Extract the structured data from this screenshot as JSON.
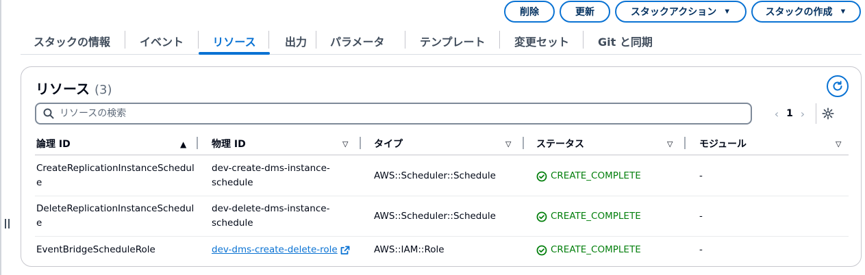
{
  "header": {
    "buttons": [
      {
        "label": "削除"
      },
      {
        "label": "更新"
      },
      {
        "label": "スタックアクション",
        "caret": "▼"
      },
      {
        "label": "スタックの作成",
        "caret": "▼"
      }
    ]
  },
  "tabs": [
    {
      "label": "スタックの情報"
    },
    {
      "label": "イベント"
    },
    {
      "label": "リソース"
    },
    {
      "label": "出力"
    },
    {
      "label": "パラメータ"
    },
    {
      "label": "テンプレート"
    },
    {
      "label": "変更セット"
    },
    {
      "label": "Git と同期"
    }
  ],
  "panel": {
    "title": "リソース",
    "count": "(3)",
    "search_placeholder": "リソースの検索",
    "page": "1"
  },
  "table": {
    "columns": [
      {
        "label": "論理 ID",
        "sort": "▲"
      },
      {
        "label": "物理 ID",
        "sort": "▽"
      },
      {
        "label": "タイプ",
        "sort": "▽"
      },
      {
        "label": "ステータス",
        "sort": "▽"
      },
      {
        "label": "モジュール",
        "sort": "▽"
      }
    ],
    "rows": [
      {
        "logical_l1": "CreateReplicationInstanceSchedul",
        "logical_l2": "e",
        "physical_l1": "dev-create-dms-instance-",
        "physical_l2": "schedule",
        "type": "AWS::Scheduler::Schedule",
        "status": "CREATE_COMPLETE",
        "module": "-"
      },
      {
        "logical_l1": "DeleteReplicationInstanceSchedul",
        "logical_l2": "e",
        "physical_l1": "dev-delete-dms-instance-",
        "physical_l2": "schedule",
        "type": "AWS::Scheduler::Schedule",
        "status": "CREATE_COMPLETE",
        "module": "-"
      },
      {
        "logical_l1": "EventBridgeScheduleRole",
        "physical_link": "dev-dms-create-delete-role",
        "type": "AWS::IAM::Role",
        "status": "CREATE_COMPLETE",
        "module": "-"
      }
    ]
  },
  "colors": {
    "accent": "#0972d3",
    "success": "#037f0c",
    "text": "#000716"
  }
}
